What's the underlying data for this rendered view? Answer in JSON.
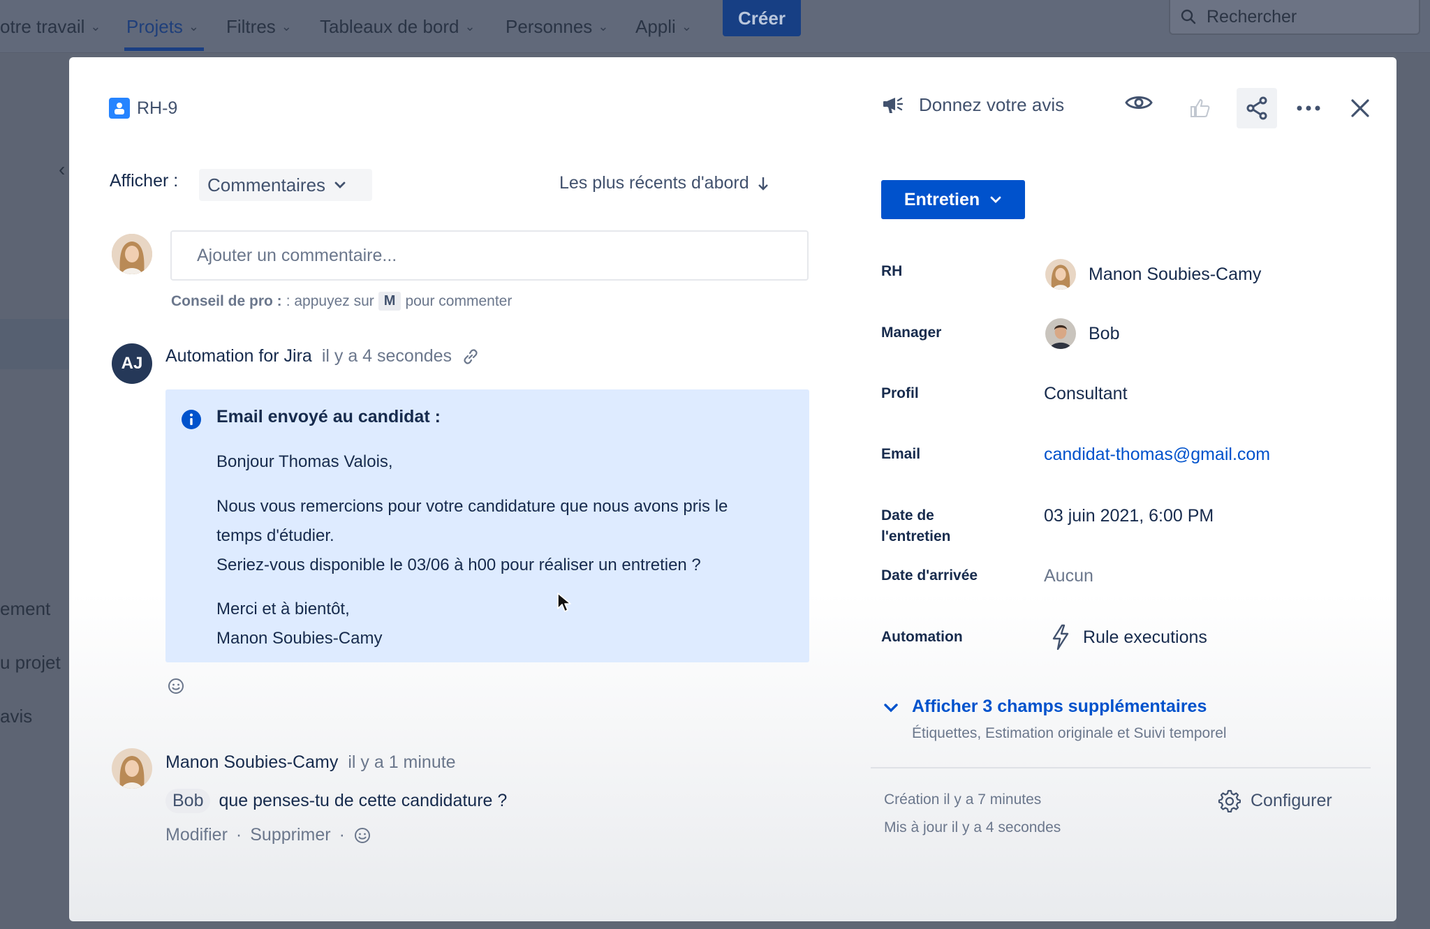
{
  "nav": {
    "items": [
      {
        "label": "otre travail",
        "active": false
      },
      {
        "label": "Projets",
        "active": true
      },
      {
        "label": "Filtres",
        "active": false
      },
      {
        "label": "Tableaux de bord",
        "active": false
      },
      {
        "label": "Personnes",
        "active": false
      },
      {
        "label": "Appli",
        "active": false
      }
    ],
    "create_label": "Créer",
    "search_placeholder": "Rechercher"
  },
  "sidebar_partial": [
    "ement",
    "u projet",
    "avis"
  ],
  "issue": {
    "key": "RH-9",
    "feedback_label": "Donnez votre avis"
  },
  "activity": {
    "show_label": "Afficher :",
    "show_value": "Commentaires",
    "sort_label": "Les plus récents d'abord",
    "comment_placeholder": "Ajouter un commentaire...",
    "pro_tip_bold": "Conseil de pro :",
    "pro_tip_prefix": ": appuyez sur",
    "pro_tip_key": "M",
    "pro_tip_suffix": "pour commenter"
  },
  "comments": [
    {
      "avatar_initials": "AJ",
      "author": "Automation for Jira",
      "time": "il y a 4 secondes",
      "panel": {
        "title": "Email envoyé au candidat :",
        "lines": [
          "Bonjour Thomas Valois,",
          "Nous vous remercions pour votre candidature que nous avons pris le",
          "temps d'étudier.",
          "Seriez-vous disponible le 03/06 à h00 pour réaliser un entretien ?",
          "Merci et à bientôt,",
          "Manon Soubies-Camy"
        ]
      }
    },
    {
      "author": "Manon Soubies-Camy",
      "time": "il y a 1 minute",
      "mention": "Bob",
      "text": "que penses-tu de cette candidature ?",
      "edit_label": "Modifier",
      "delete_label": "Supprimer",
      "separator": "·"
    }
  ],
  "details": {
    "status": "Entretien",
    "fields": {
      "rh_label": "RH",
      "rh_value": "Manon Soubies-Camy",
      "manager_label": "Manager",
      "manager_value": "Bob",
      "profile_label": "Profil",
      "profile_value": "Consultant",
      "email_label": "Email",
      "email_value": "candidat-thomas@gmail.com",
      "interview_date_label_1": "Date de",
      "interview_date_label_2": "l'entretien",
      "interview_date_value": "03 juin 2021, 6:00 PM",
      "arrival_date_label": "Date d'arrivée",
      "arrival_date_value": "Aucun",
      "automation_label": "Automation",
      "automation_value": "Rule executions"
    },
    "more_fields_title": "Afficher 3 champs supplémentaires",
    "more_fields_sub": "Étiquettes, Estimation originale et Suivi temporel",
    "created": "Création il y a 7 minutes",
    "updated": "Mis à jour il y a 4 secondes",
    "configure_label": "Configurer"
  },
  "colors": {
    "primary": "#0052cc",
    "panel_bg": "#deebff",
    "info_icon": "#0052cc",
    "text": "#172b4d"
  }
}
